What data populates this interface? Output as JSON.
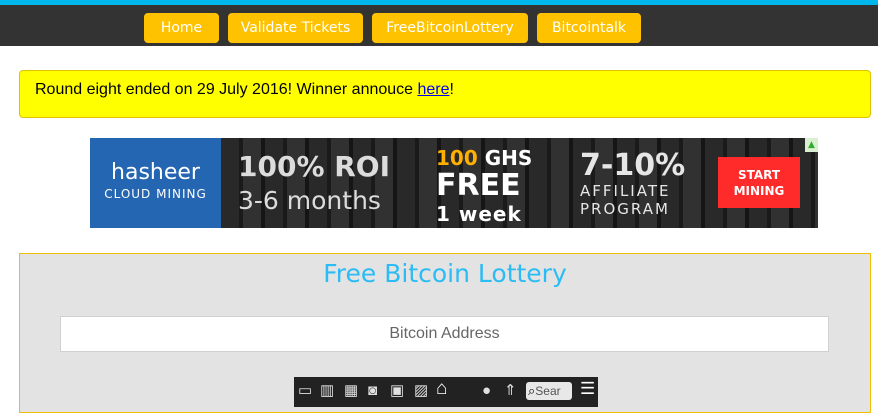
{
  "nav": {
    "items": [
      {
        "label": "Home"
      },
      {
        "label": "Validate Tickets"
      },
      {
        "label": "FreeBitcoinLottery"
      },
      {
        "label": "Bitcointalk"
      }
    ],
    "accent": "#00b7ee",
    "button_color": "#ffc200"
  },
  "notice": {
    "text": "Round eight ended on 29 July 2016! Winner annouce ",
    "link": "here",
    "suffix": "!"
  },
  "banner": {
    "brand": "hasheer",
    "brand_sub": "CLOUD MINING",
    "roi": "100% ROI",
    "months": "3-6 months",
    "ghs_num": "100",
    "ghs_unit": " GHS",
    "free": "FREE",
    "week": "1 week",
    "affiliate_pct": "7-10%",
    "affiliate_1": "AFFILIATE",
    "affiliate_2": "PROGRAM",
    "cta_1": "START",
    "cta_2": "MINING"
  },
  "panel": {
    "title": "Free Bitcoin Lottery",
    "address_placeholder": "Bitcoin Address"
  },
  "toolbar": {
    "icons": [
      "window-icon",
      "book-icon",
      "film-icon",
      "speaker-icon",
      "save-icon",
      "images-icon",
      "bank-icon",
      "user-icon",
      "upload-icon",
      "search-icon",
      "menu-icon"
    ],
    "search_placeholder": "Sear"
  }
}
